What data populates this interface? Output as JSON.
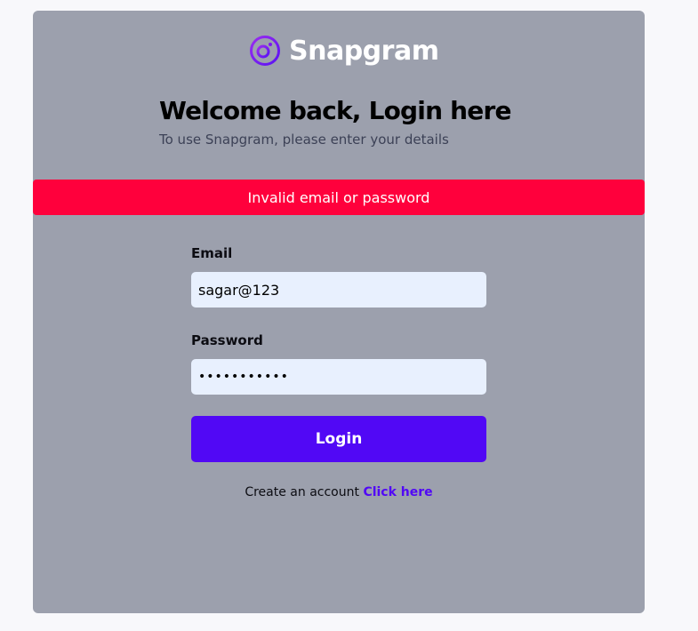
{
  "brand": {
    "name": "Snapgram",
    "logo_icon": "camera-ring-icon",
    "logo_color": "#7c18f2"
  },
  "header": {
    "title": "Welcome back, Login here",
    "subtitle": "To use Snapgram, please enter your details"
  },
  "alert": {
    "message": "Invalid email or password",
    "color": "#ff003c"
  },
  "form": {
    "email_label": "Email",
    "email_value": "sagar@123",
    "password_label": "Password",
    "password_value": "sagar@12345",
    "login_label": "Login",
    "login_color": "#5108f5"
  },
  "footer": {
    "prompt": "Create an account",
    "link_label": "Click here"
  }
}
